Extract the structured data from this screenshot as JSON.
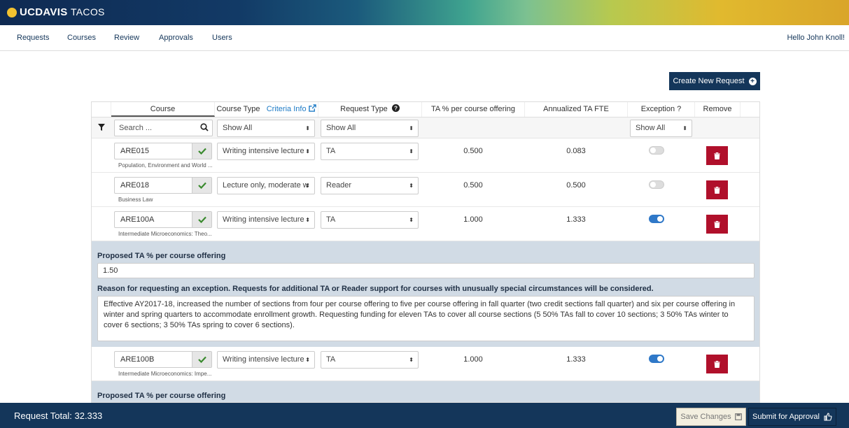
{
  "app": {
    "logo_main": "UCDAVIS",
    "logo_sub": "TACOS"
  },
  "nav": {
    "items": [
      "Requests",
      "Courses",
      "Review",
      "Approvals",
      "Users"
    ],
    "greeting": "Hello John Knoll!"
  },
  "create_button": "Create New Request",
  "table": {
    "headers": {
      "course": "Course",
      "course_type": "Course Type",
      "criteria_info": "Criteria Info",
      "request_type": "Request Type",
      "ta_pct": "TA % per course offering",
      "annualized": "Annualized TA FTE",
      "exception": "Exception ?",
      "remove": "Remove"
    },
    "filters": {
      "search_placeholder": "Search ...",
      "course_type": "Show All",
      "request_type": "Show All",
      "exception": "Show All"
    },
    "rows": [
      {
        "course": "ARE015",
        "desc": "Population, Environment and World ...",
        "course_type": "Writing intensive lecture",
        "request_type": "TA",
        "ta_pct": "0.500",
        "annualized": "0.083",
        "exception": false
      },
      {
        "course": "ARE018",
        "desc": "Business Law",
        "course_type": "Lecture only, moderate w",
        "request_type": "Reader",
        "ta_pct": "0.500",
        "annualized": "0.500",
        "exception": false
      },
      {
        "course": "ARE100A",
        "desc": "Intermediate Microeconomics: Theo...",
        "course_type": "Writing intensive lecture",
        "request_type": "TA",
        "ta_pct": "1.000",
        "annualized": "1.333",
        "exception": true
      },
      {
        "course": "ARE100B",
        "desc": "Intermediate Microeconomics: Impe...",
        "course_type": "Writing intensive lecture",
        "request_type": "TA",
        "ta_pct": "1.000",
        "annualized": "1.333",
        "exception": true
      }
    ],
    "exceptions": [
      {
        "proposed_label": "Proposed TA % per course offering",
        "proposed_value": "1.50",
        "reason_label": "Reason for requesting an exception. Requests for additional TA or Reader support for courses with unusually special circumstances will be considered.",
        "reason_text": "Effective AY2017-18, increased the number of sections from four per course offering to five per course offering in fall quarter (two credit sections fall quarter) and six per course offering in winter and spring quarters to accommodate enrollment growth. Requesting funding for eleven TAs to cover all course sections (5 50% TAs fall to cover 10 sections; 3 50% TAs winter to cover 6 sections; 3 50% TAs spring to cover 6 sections)."
      },
      {
        "proposed_label": "Proposed TA % per course offering"
      }
    ]
  },
  "footer": {
    "total": "Request Total: 32.333",
    "save": "Save Changes",
    "submit": "Submit for Approval"
  },
  "colors": {
    "navy": "#14365a",
    "danger": "#b0102b",
    "toggle_on": "#2f78c8",
    "exception_bg": "#d1dbe5"
  }
}
